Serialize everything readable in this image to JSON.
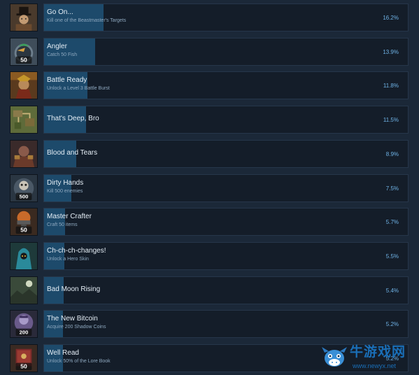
{
  "achievements": [
    {
      "title": "Go On...",
      "description": "Kill one of the Beastmaster's Targets",
      "percent_label": "16.2%",
      "percent": 16.2,
      "icon": "top-hat-gentleman-icon",
      "icon_badge": ""
    },
    {
      "title": "Angler",
      "description": "Catch 50 Fish",
      "percent_label": "13.9%",
      "percent": 13.9,
      "icon": "fish-50-badge-icon",
      "icon_badge": "50"
    },
    {
      "title": "Battle Ready",
      "description": "Unlock a Level 3 Battle Burst",
      "percent_label": "11.8%",
      "percent": 11.8,
      "icon": "warrior-portrait-icon",
      "icon_badge": ""
    },
    {
      "title": "That's Deep, Bro",
      "description": "",
      "percent_label": "11.5%",
      "percent": 11.5,
      "icon": "dungeon-map-icon",
      "icon_badge": ""
    },
    {
      "title": "Blood and Tears",
      "description": "",
      "percent_label": "8.9%",
      "percent": 8.9,
      "icon": "armored-brute-icon",
      "icon_badge": ""
    },
    {
      "title": "Dirty Hands",
      "description": "Kill 500 enemies",
      "percent_label": "7.5%",
      "percent": 7.5,
      "icon": "skull-500-badge-icon",
      "icon_badge": "500"
    },
    {
      "title": "Master Crafter",
      "description": "Craft 50 items",
      "percent_label": "5.7%",
      "percent": 5.7,
      "icon": "anvil-50-badge-icon",
      "icon_badge": "50"
    },
    {
      "title": "Ch-ch-ch-changes!",
      "description": "Unlock a Hero Skin",
      "percent_label": "5.5%",
      "percent": 5.5,
      "icon": "hooded-hero-icon",
      "icon_badge": ""
    },
    {
      "title": "Bad Moon Rising",
      "description": "",
      "percent_label": "5.4%",
      "percent": 5.4,
      "icon": "moonlit-landscape-icon",
      "icon_badge": ""
    },
    {
      "title": "The New Bitcoin",
      "description": "Acquire 200 Shadow Coins",
      "percent_label": "5.2%",
      "percent": 5.2,
      "icon": "coins-200-badge-icon",
      "icon_badge": "200"
    },
    {
      "title": "Well Read",
      "description": "Unlock 50% of the Lore Book",
      "percent_label": "5.2%",
      "percent": 5.2,
      "icon": "lore-book-50-badge-icon",
      "icon_badge": "50"
    }
  ],
  "watermark": {
    "brand": "牛游戏网",
    "url": "www.newyx.net"
  },
  "colors": {
    "background": "#1b2838",
    "panel": "#141d29",
    "progress_fill": "#1d4a6b",
    "title": "#e4edf5",
    "description": "#8ea8bf",
    "percent": "#6fb3e6",
    "watermark": "#1a6fb8"
  }
}
